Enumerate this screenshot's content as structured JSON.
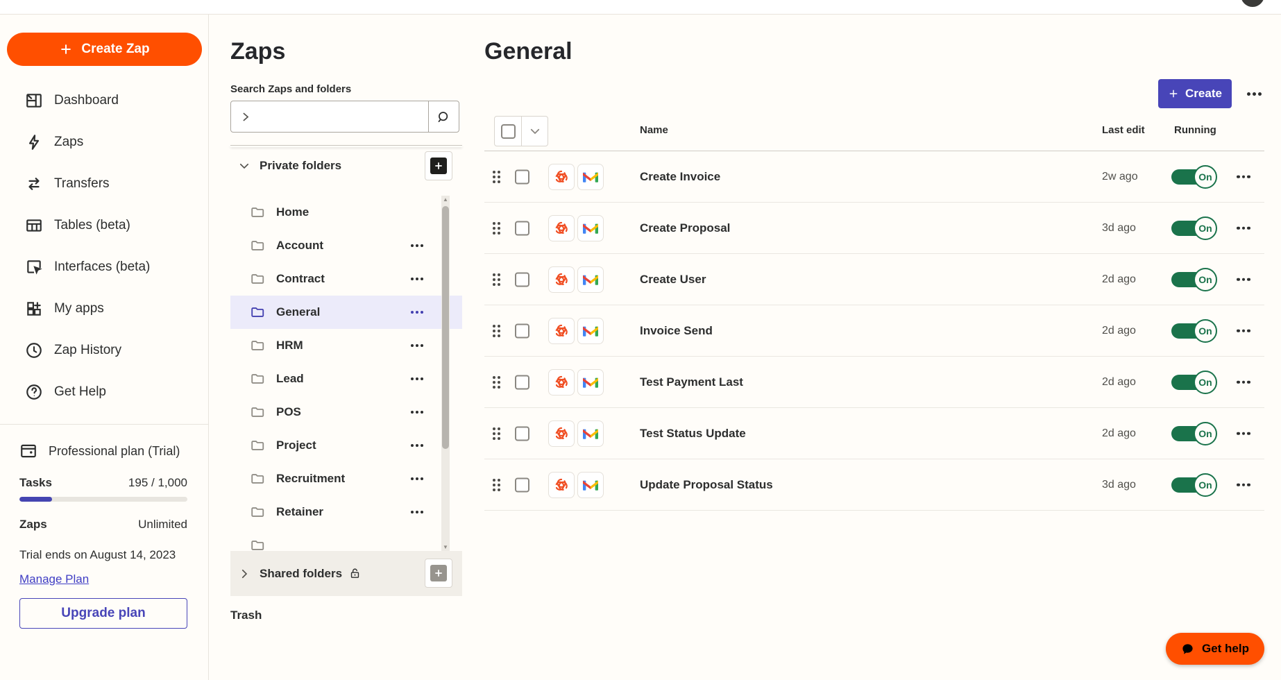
{
  "colors": {
    "orange": "#FF4F00",
    "indigo": "#4845B8",
    "green": "#1A734B",
    "selection": "#ECEBFA"
  },
  "sidebar": {
    "create_zap": "Create Zap",
    "nav": [
      {
        "label": "Dashboard",
        "icon": "dashboard-icon"
      },
      {
        "label": "Zaps",
        "icon": "zap-bolt-icon"
      },
      {
        "label": "Transfers",
        "icon": "transfer-arrows-icon"
      },
      {
        "label": "Tables (beta)",
        "icon": "table-icon"
      },
      {
        "label": "Interfaces (beta)",
        "icon": "interfaces-icon"
      },
      {
        "label": "My apps",
        "icon": "apps-grid-icon"
      },
      {
        "label": "Zap History",
        "icon": "clock-icon"
      },
      {
        "label": "Get Help",
        "icon": "question-circle-icon"
      }
    ],
    "plan": {
      "title": "Professional plan (Trial)",
      "tasks_label": "Tasks",
      "tasks_value": "195 / 1,000",
      "tasks_percent": 19.5,
      "zaps_label": "Zaps",
      "zaps_value": "Unlimited",
      "trial_note": "Trial ends on August 14, 2023",
      "manage_link": "Manage Plan",
      "upgrade_button": "Upgrade plan"
    }
  },
  "folders_panel": {
    "title": "Zaps",
    "search_label": "Search Zaps and folders",
    "search_value": "",
    "private_section": "Private folders",
    "folders": [
      {
        "name": "Home",
        "menu": false,
        "selected": false
      },
      {
        "name": "Account",
        "menu": true,
        "selected": false
      },
      {
        "name": "Contract",
        "menu": true,
        "selected": false
      },
      {
        "name": "General",
        "menu": true,
        "selected": true
      },
      {
        "name": "HRM",
        "menu": true,
        "selected": false
      },
      {
        "name": "Lead",
        "menu": true,
        "selected": false
      },
      {
        "name": "POS",
        "menu": true,
        "selected": false
      },
      {
        "name": "Project",
        "menu": true,
        "selected": false
      },
      {
        "name": "Recruitment",
        "menu": true,
        "selected": false
      },
      {
        "name": "Retainer",
        "menu": true,
        "selected": false
      },
      {
        "name": "",
        "menu": false,
        "selected": false,
        "partial": true
      }
    ],
    "shared_section": "Shared folders",
    "trash": "Trash"
  },
  "main": {
    "title": "General",
    "create_button": "Create",
    "columns": {
      "name": "Name",
      "last_edit": "Last edit",
      "running": "Running"
    },
    "apps": [
      "webhooks-icon",
      "gmail-icon"
    ],
    "rows": [
      {
        "name": "Create Invoice",
        "last_edit": "2w ago",
        "running": "On"
      },
      {
        "name": "Create Proposal",
        "last_edit": "3d ago",
        "running": "On"
      },
      {
        "name": "Create User",
        "last_edit": "2d ago",
        "running": "On"
      },
      {
        "name": "Invoice Send",
        "last_edit": "2d ago",
        "running": "On"
      },
      {
        "name": "Test Payment Last",
        "last_edit": "2d ago",
        "running": "On"
      },
      {
        "name": "Test Status Update",
        "last_edit": "2d ago",
        "running": "On"
      },
      {
        "name": "Update Proposal Status",
        "last_edit": "3d ago",
        "running": "On"
      }
    ]
  },
  "help_button": {
    "label": "Get help"
  }
}
